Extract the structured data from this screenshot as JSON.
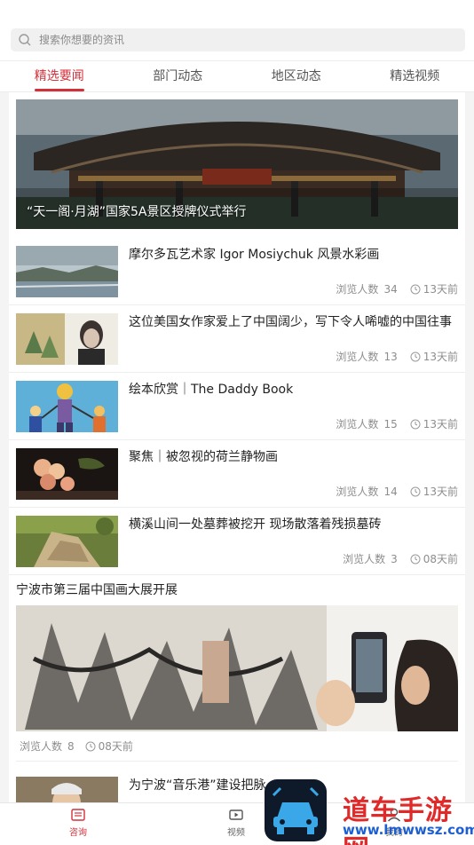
{
  "search": {
    "placeholder": "搜索你想要的资讯"
  },
  "tabs": [
    {
      "label": "精选要闻",
      "active": true
    },
    {
      "label": "部门动态",
      "active": false
    },
    {
      "label": "地区动态",
      "active": false
    },
    {
      "label": "精选视频",
      "active": false
    }
  ],
  "hero": {
    "title": "“天一阁·月湖”国家5A景区授牌仪式举行"
  },
  "meta_labels": {
    "views": "浏览人数"
  },
  "news": [
    {
      "title": "摩尔多瓦艺术家 Igor Mosiychuk 风景水彩画",
      "views": "34",
      "time": "13天前"
    },
    {
      "title": "这位美国女作家爱上了中国阔少，写下令人唏嘘的中国往事",
      "views": "13",
      "time": "13天前"
    },
    {
      "title": "绘本欣赏｜The Daddy Book",
      "views": "15",
      "time": "13天前"
    },
    {
      "title": "聚焦｜被忽视的荷兰静物画",
      "views": "14",
      "time": "13天前"
    },
    {
      "title": "横溪山间一处墓葬被挖开 现场散落着残损墓砖",
      "views": "3",
      "time": "08天前"
    }
  ],
  "featured": {
    "title": "宁波市第三届中国画大展开展",
    "views": "8",
    "time": "08天前"
  },
  "partial": {
    "title": "为宁波“音乐港”建设把脉"
  },
  "bottom_nav": [
    {
      "label": "咨询",
      "icon": "news-icon",
      "active": true
    },
    {
      "label": "视频",
      "icon": "video-icon",
      "active": false
    },
    {
      "label": "我的",
      "icon": "user-icon",
      "active": false
    }
  ],
  "watermark": {
    "brand": "道车手游网",
    "url": "www.lmwwsz.com"
  },
  "colors": {
    "accent": "#d4303a",
    "muted": "#8d8d8d"
  }
}
